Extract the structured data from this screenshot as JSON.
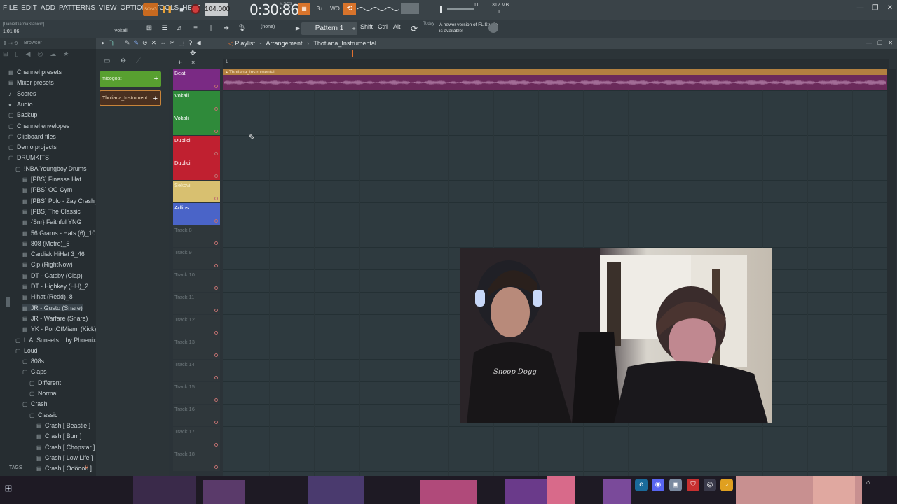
{
  "menu": [
    "FILE",
    "EDIT",
    "ADD",
    "PATTERNS",
    "VIEW",
    "OPTIONS",
    "TOOLS",
    "HELP"
  ],
  "transport": {
    "song_label": "SONG",
    "pause": "❚❚",
    "stop": "■",
    "tempo": "104.000",
    "time": "0:30:86",
    "time_label": "M:S:CS"
  },
  "toolbar_buttons": {
    "metronome": "▦",
    "countdown": "3♪",
    "wait": "WO",
    "loop": "⟲"
  },
  "cpu": "11",
  "memory": "312 MB",
  "poly": "1",
  "window_controls": [
    "—",
    "❐",
    "✕"
  ],
  "hint": {
    "user": "[DanielGarciaStanicic]",
    "time": "1:01:06",
    "track": "Vokali"
  },
  "pattern": {
    "none": "(none)",
    "selected": "Pattern 1"
  },
  "keys": {
    "shift": "Shift",
    "ctrl": "Ctrl",
    "alt": "Alt"
  },
  "news": {
    "today": "Today",
    "text": "A newer version of FL Studio is available!"
  },
  "browser": {
    "title": "Browser",
    "items": [
      {
        "label": "Channel presets",
        "icon": "▤",
        "indent": 0
      },
      {
        "label": "Mixer presets",
        "icon": "▤",
        "indent": 0
      },
      {
        "label": "Scores",
        "icon": "♪",
        "indent": 0
      },
      {
        "label": "Audio",
        "icon": "●",
        "indent": 0
      },
      {
        "label": "Backup",
        "icon": "▢",
        "indent": 0
      },
      {
        "label": "Channel envelopes",
        "icon": "▢",
        "indent": 0
      },
      {
        "label": "Clipboard files",
        "icon": "▢",
        "indent": 0
      },
      {
        "label": "Demo projects",
        "icon": "▢",
        "indent": 0
      },
      {
        "label": "DRUMKITS",
        "icon": "▢",
        "indent": 0
      },
      {
        "label": "!NBA Youngboy Drums",
        "icon": "▢",
        "indent": 1
      },
      {
        "label": "[PBS] Finesse Hat",
        "icon": "▤",
        "indent": 2
      },
      {
        "label": "[PBS] OG Cym",
        "icon": "▤",
        "indent": 2
      },
      {
        "label": "[PBS] Polo - Zay Crash_3",
        "icon": "▤",
        "indent": 2
      },
      {
        "label": "[PBS] The Classic",
        "icon": "▤",
        "indent": 2
      },
      {
        "label": "{Snr} Faithful YNG",
        "icon": "▤",
        "indent": 2
      },
      {
        "label": "56 Grams - Hats (6)_10",
        "icon": "▤",
        "indent": 2
      },
      {
        "label": "808 (Metro)_5",
        "icon": "▤",
        "indent": 2
      },
      {
        "label": "Cardiak HiHat 3_46",
        "icon": "▤",
        "indent": 2
      },
      {
        "label": "Clp (RightNow)",
        "icon": "▤",
        "indent": 2
      },
      {
        "label": "DT - Gatsby (Clap)",
        "icon": "▤",
        "indent": 2
      },
      {
        "label": "DT - Highkey (HH)_2",
        "icon": "▤",
        "indent": 2
      },
      {
        "label": "Hihat (Redd)_8",
        "icon": "▤",
        "indent": 2
      },
      {
        "label": "JR - Gusto (Snare)",
        "icon": "▤",
        "indent": 2,
        "selected": true
      },
      {
        "label": "JR - Warfare (Snare)",
        "icon": "▤",
        "indent": 2
      },
      {
        "label": "YK - PortOfMiami (Kick)_2",
        "icon": "▤",
        "indent": 2
      },
      {
        "label": "L.A. Sunsets... by Phoenix)",
        "icon": "▢",
        "indent": 1
      },
      {
        "label": "Loud",
        "icon": "▢",
        "indent": 1
      },
      {
        "label": "808s",
        "icon": "▢",
        "indent": 2
      },
      {
        "label": "Claps",
        "icon": "▢",
        "indent": 2
      },
      {
        "label": "Different",
        "icon": "▢",
        "indent": 3
      },
      {
        "label": "Normal",
        "icon": "▢",
        "indent": 3
      },
      {
        "label": "Crash",
        "icon": "▢",
        "indent": 2
      },
      {
        "label": "Classic",
        "icon": "▢",
        "indent": 3
      },
      {
        "label": "Crash [ Beastie ]",
        "icon": "▤",
        "indent": 4
      },
      {
        "label": "Crash [ Burr ]",
        "icon": "▤",
        "indent": 4
      },
      {
        "label": "Crash [ Chopstar ]",
        "icon": "▤",
        "indent": 4
      },
      {
        "label": "Crash [ Low Life ]",
        "icon": "▤",
        "indent": 4
      },
      {
        "label": "Crash [ Oooooh ]",
        "icon": "▤",
        "indent": 4
      }
    ],
    "tags": "TAGS"
  },
  "clips": [
    {
      "label": "micogoat",
      "plus": "+"
    },
    {
      "label": "Thotiana_Instrument...",
      "plus": "+"
    }
  ],
  "playlist": {
    "title": "Playlist",
    "view": "Arrangement",
    "pattern": "Thotiana_Instrumental",
    "ruler_start": "1",
    "clip_label": "Thotiana_Instrumental",
    "tracks": [
      {
        "name": "Beat",
        "color": "#7a2a84"
      },
      {
        "name": "Vokali",
        "color": "#2f8a3a"
      },
      {
        "name": "Vokali",
        "color": "#2f8a3a"
      },
      {
        "name": "Duplici",
        "color": "#c02030"
      },
      {
        "name": "Duplici",
        "color": "#c02030"
      },
      {
        "name": "Sekovi",
        "color": "#d8c070"
      },
      {
        "name": "Adlibs",
        "color": "#4a64c8"
      },
      {
        "name": "Track 8",
        "color": ""
      },
      {
        "name": "Track 9",
        "color": ""
      },
      {
        "name": "Track 10",
        "color": ""
      },
      {
        "name": "Track 11",
        "color": ""
      },
      {
        "name": "Track 12",
        "color": ""
      },
      {
        "name": "Track 13",
        "color": ""
      },
      {
        "name": "Track 14",
        "color": ""
      },
      {
        "name": "Track 15",
        "color": ""
      },
      {
        "name": "Track 16",
        "color": ""
      },
      {
        "name": "Track 17",
        "color": ""
      },
      {
        "name": "Track 18",
        "color": ""
      }
    ]
  },
  "webcam": {
    "shirt_text": "Snoop Dogg"
  },
  "taskbar": {
    "start": "⊞"
  }
}
